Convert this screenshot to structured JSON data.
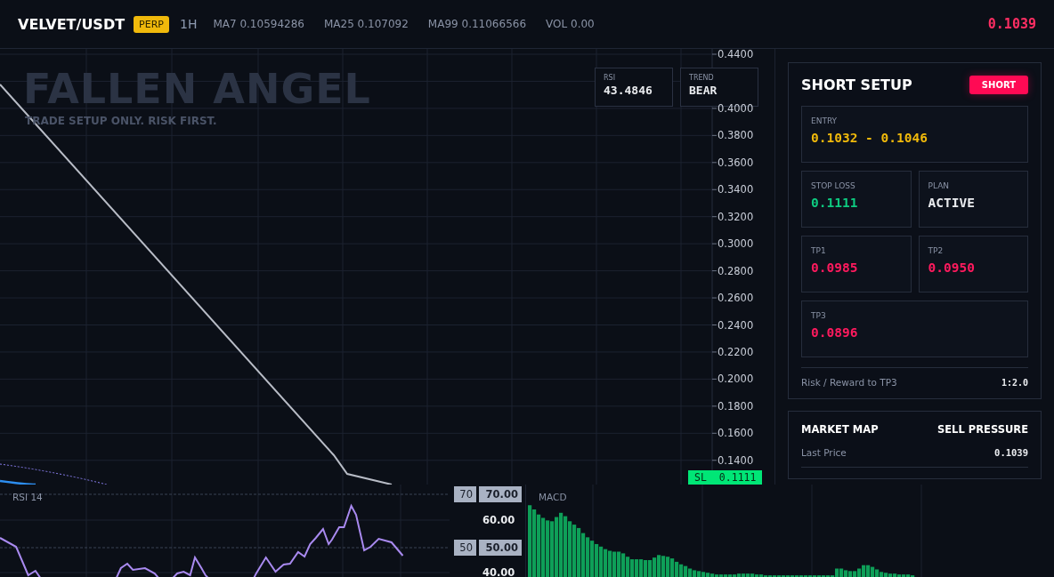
{
  "header": {
    "symbol": "VELVET/USDT",
    "badge": "PERP",
    "interval": "1H",
    "stats": [
      "MA7 0.10594286",
      "MA25 0.107092",
      "MA99 0.11066566",
      "VOL 0.00"
    ],
    "last_price": "0.1039"
  },
  "chart": {
    "watermark_title": "FALLEN ANGEL",
    "watermark_subtitle": "TRADE SETUP ONLY. RISK FIRST.",
    "info_boxes": [
      {
        "label": "RSI",
        "value": "43.4846"
      },
      {
        "label": "TREND",
        "value": "BEAR"
      }
    ],
    "price_axis": [
      "0.4400",
      "0.4000",
      "0.3800",
      "0.3600",
      "0.3400",
      "0.3200",
      "0.3000",
      "0.2800",
      "0.2600",
      "0.2400",
      "0.2200",
      "0.2000",
      "0.1800",
      "0.1600",
      "0.1400"
    ],
    "sl_tag": {
      "label": "SL",
      "value": "0.1111"
    }
  },
  "setup": {
    "title": "SHORT SETUP",
    "badge": "SHORT",
    "cells": [
      {
        "label": "ENTRY",
        "value": "0.1032 - 0.1046",
        "kind": "wide",
        "color": "#f0b90b"
      },
      {
        "label": "STOP LOSS",
        "value": "0.1111",
        "kind": "half",
        "color": "#0ecb81"
      },
      {
        "label": "PLAN",
        "value": "ACTIVE",
        "kind": "half",
        "color": "#eaecef"
      },
      {
        "label": "TP1",
        "value": "0.0985",
        "kind": "half",
        "color": "#ff1a5e"
      },
      {
        "label": "TP2",
        "value": "0.0950",
        "kind": "half",
        "color": "#ff1a5e"
      },
      {
        "label": "TP3",
        "value": "0.0896",
        "kind": "wide",
        "color": "#ff1a5e"
      }
    ],
    "risk_label": "Risk / Reward to TP3",
    "risk_value": "1:2.0"
  },
  "market_map": {
    "title": "MARKET MAP",
    "status": "SELL PRESSURE",
    "rows": [
      {
        "label": "Last Price",
        "value": "0.1039"
      }
    ]
  },
  "rsi_panel": {
    "title": "RSI 14",
    "levels": [
      {
        "tag": "70",
        "value": "70.00"
      },
      {
        "tag": "50",
        "value": "50.00"
      }
    ],
    "axis": [
      "60.00",
      "40.00"
    ]
  },
  "macd_panel": {
    "title": "MACD"
  }
}
